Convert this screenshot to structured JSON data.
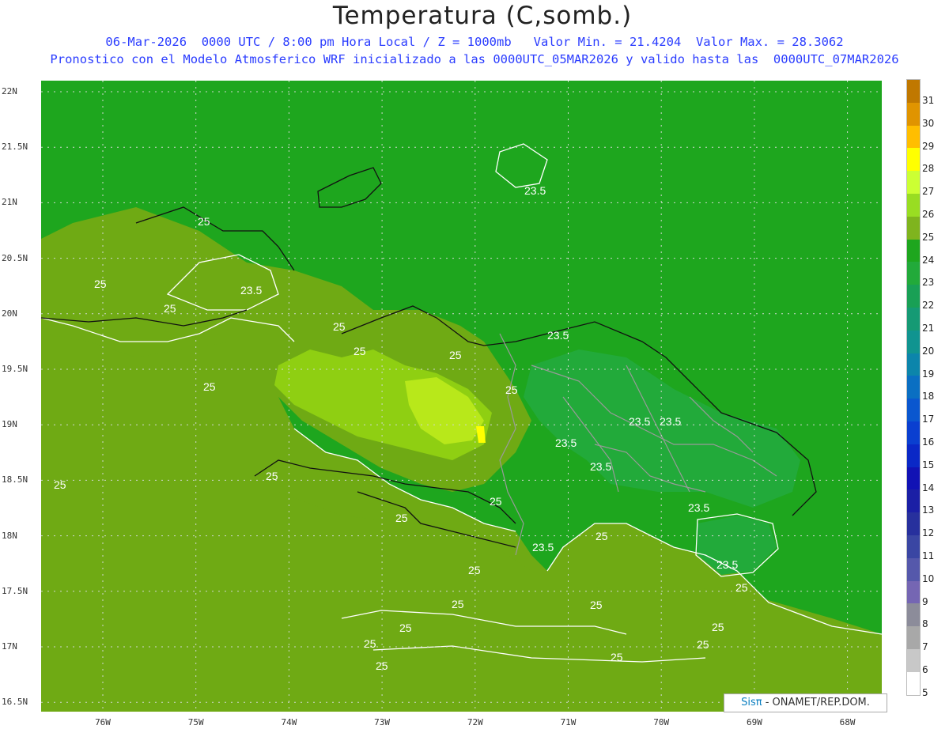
{
  "header": {
    "title": "Temperatura (C,somb.)",
    "subtitle1": "06-Mar-2026  0000 UTC / 8:00 pm Hora Local / Z = 1000mb   Valor Min. = 21.4204  Valor Max. = 28.3062",
    "subtitle2": "Pronostico con el Modelo Atmosferico WRF inicializado a las 0000UTC_05MAR2026 y valido hasta las  0000UTC_07MAR2026"
  },
  "axes": {
    "lat_labels": [
      "22N",
      "21.5N",
      "21N",
      "20.5N",
      "20N",
      "19.5N",
      "19N",
      "18.5N",
      "18N",
      "17.5N",
      "17N",
      "16.5N"
    ],
    "lon_labels": [
      "76W",
      "75W",
      "74W",
      "73W",
      "72W",
      "71W",
      "70W",
      "69W",
      "68W"
    ]
  },
  "contour_labels": {
    "values": [
      "25",
      "25",
      "25",
      "25",
      "25",
      "25",
      "25",
      "25",
      "25",
      "25",
      "25",
      "25",
      "25",
      "25",
      "25",
      "25",
      "25",
      "25",
      "25",
      "25",
      "25",
      "25",
      "25",
      "23.5",
      "23.5",
      "23.5",
      "23.5",
      "23.5",
      "23.5",
      "23.5",
      "23.5",
      "23.5",
      "23.5"
    ]
  },
  "colorbar": {
    "labels": [
      "31",
      "30",
      "29",
      "28",
      "27",
      "26",
      "25",
      "24",
      "23",
      "22",
      "21",
      "20",
      "19",
      "18",
      "17",
      "16",
      "15",
      "14",
      "13",
      "12",
      "11",
      "10",
      "9",
      "8",
      "7",
      "6",
      "5"
    ],
    "colors": [
      "#c07800",
      "#e09400",
      "#ffbe00",
      "#ffff00",
      "#ccff33",
      "#99dd22",
      "#7fb41e",
      "#1ea61e",
      "#22aa3a",
      "#19a055",
      "#159a74",
      "#109490",
      "#0c85ab",
      "#0a6fc2",
      "#0a57cf",
      "#0a3fd0",
      "#0a28c6",
      "#1112b4",
      "#1b1fa5",
      "#27309d",
      "#3a46a3",
      "#5558ab",
      "#7566b3",
      "#8c8c9a",
      "#a8a8a8",
      "#c8c8c8",
      "#ffffff"
    ]
  },
  "credit": {
    "brand": "Sisπ",
    "text": " - ONAMET/REP.DOM."
  },
  "colors": {
    "subtitle": "#2a3cff",
    "sea_fill": "#6faa14",
    "land_fill": "#1ea61e",
    "warm_fill": "#8fcf12"
  }
}
